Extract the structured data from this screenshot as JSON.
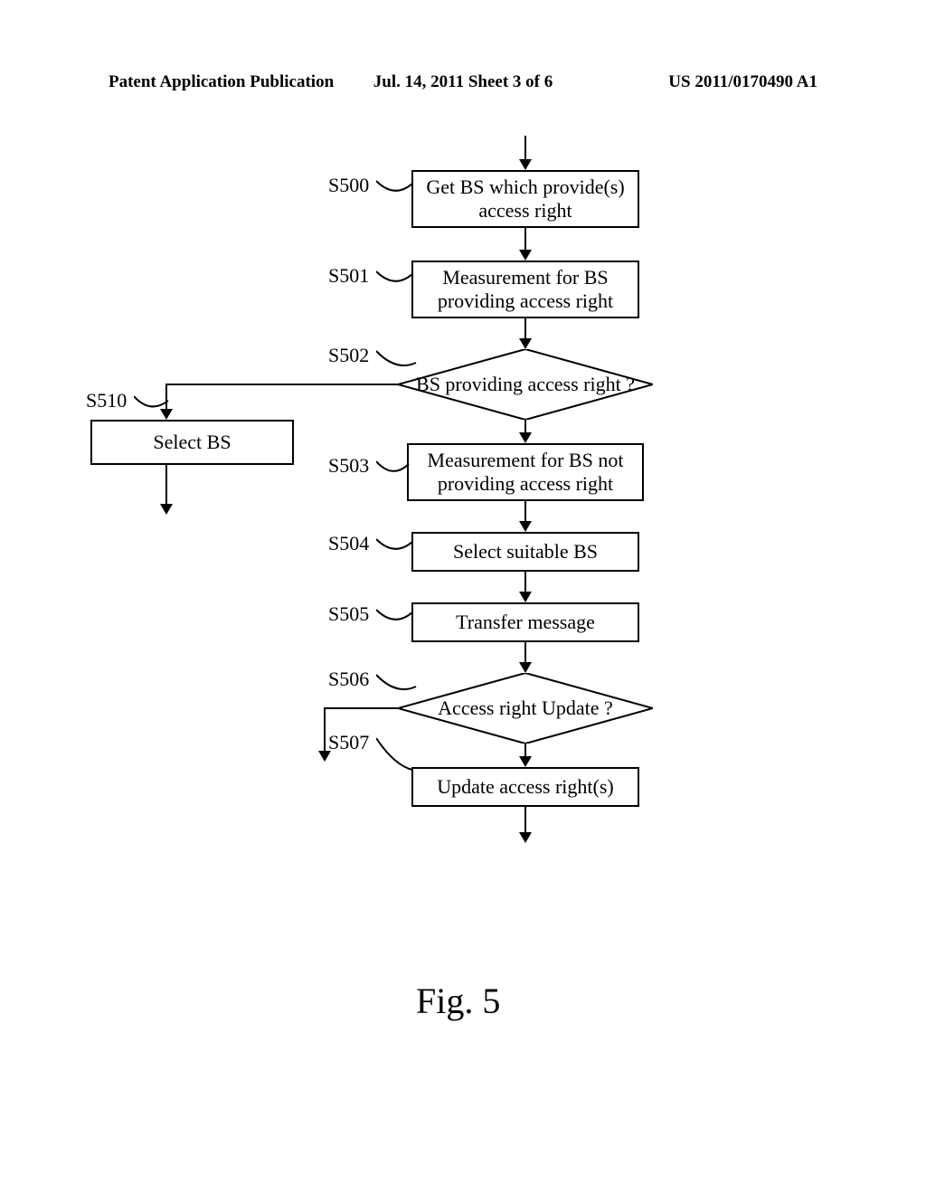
{
  "header": {
    "left": "Patent Application Publication",
    "center": "Jul. 14, 2011  Sheet 3 of 6",
    "right": "US 2011/0170490 A1"
  },
  "steps": {
    "s500": {
      "label": "S500",
      "text": "Get BS which provide(s) access right"
    },
    "s501": {
      "label": "S501",
      "text": "Measurement for BS providing access right"
    },
    "s502": {
      "label": "S502",
      "text": "BS providing access right ?"
    },
    "s503": {
      "label": "S503",
      "text": "Measurement for BS not providing access right"
    },
    "s504": {
      "label": "S504",
      "text": "Select suitable BS"
    },
    "s505": {
      "label": "S505",
      "text": "Transfer message"
    },
    "s506": {
      "label": "S506",
      "text": "Access right Update ?"
    },
    "s507": {
      "label": "S507",
      "text": "Update access right(s)"
    },
    "s510": {
      "label": "S510",
      "text": "Select BS"
    }
  },
  "figure": "Fig. 5"
}
